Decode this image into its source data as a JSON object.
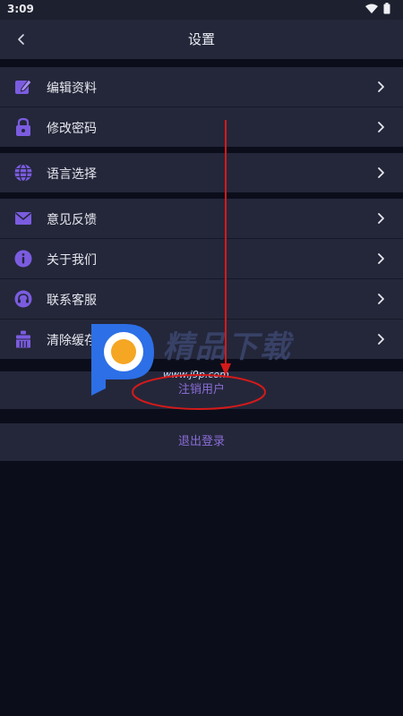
{
  "status_bar": {
    "time": "3:09",
    "icons": [
      "wifi-icon",
      "battery-icon"
    ]
  },
  "header": {
    "title": "设置",
    "back_icon": "chevron-left-icon"
  },
  "groups": [
    {
      "items": [
        {
          "label": "编辑资料",
          "icon": "edit-profile-icon"
        },
        {
          "label": "修改密码",
          "icon": "lock-icon"
        }
      ]
    },
    {
      "items": [
        {
          "label": "语言选择",
          "icon": "globe-icon"
        }
      ]
    },
    {
      "items": [
        {
          "label": "意见反馈",
          "icon": "mail-icon"
        },
        {
          "label": "关于我们",
          "icon": "info-icon"
        },
        {
          "label": "联系客服",
          "icon": "headset-icon"
        },
        {
          "label": "清除缓存",
          "icon": "broom-icon"
        }
      ]
    }
  ],
  "actions": {
    "deactivate_label": "注销用户",
    "logout_label": "退出登录"
  },
  "watermark": {
    "text": "精品下载",
    "url": "www.j9p.com"
  },
  "colors": {
    "background": "#0b0e1a",
    "surface": "#24273a",
    "accent": "#8a6cd6",
    "annotation": "#d41a1a"
  }
}
